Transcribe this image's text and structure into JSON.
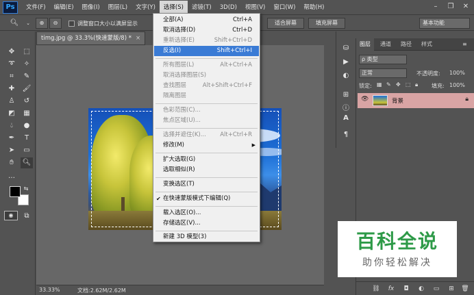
{
  "app": {
    "logo": "Ps"
  },
  "menubar": {
    "items": [
      "文件(F)",
      "编辑(E)",
      "图像(I)",
      "图层(L)",
      "文字(Y)",
      "选择(S)",
      "滤镜(T)",
      "3D(D)",
      "视图(V)",
      "窗口(W)",
      "帮助(H)"
    ],
    "active_index": 5
  },
  "options": {
    "resize_windows_label": "调整窗口大小以满屏显示",
    "fit_screen_label": "适合屏幕",
    "fill_screen_label": "填充屏幕",
    "workspace": "基本功能"
  },
  "document": {
    "tab_title": "timg.jpg @ 33.3%(快速蒙版/8) *",
    "close_glyph": "×",
    "zoom": "33.33%",
    "doc_size": "文档:2.62M/2.62M"
  },
  "select_menu": {
    "items": [
      {
        "label": "全部(A)",
        "shortcut": "Ctrl+A",
        "disabled": false
      },
      {
        "label": "取消选择(D)",
        "shortcut": "Ctrl+D",
        "disabled": false
      },
      {
        "label": "重新选择(E)",
        "shortcut": "Shift+Ctrl+D",
        "disabled": true
      },
      {
        "label": "反选(I)",
        "shortcut": "Shift+Ctrl+I",
        "disabled": false,
        "highlighted": true
      },
      {
        "label": "所有图层(L)",
        "shortcut": "Alt+Ctrl+A",
        "disabled": true
      },
      {
        "label": "取消选择图层(S)",
        "shortcut": "",
        "disabled": true
      },
      {
        "label": "查找图层",
        "shortcut": "Alt+Shift+Ctrl+F",
        "disabled": true
      },
      {
        "label": "隔离图层",
        "shortcut": "",
        "disabled": true
      },
      {
        "label": "色彩范围(C)...",
        "shortcut": "",
        "disabled": true
      },
      {
        "label": "焦点区域(U)...",
        "shortcut": "",
        "disabled": true
      },
      {
        "label": "选择并遮住(K)...",
        "shortcut": "Alt+Ctrl+R",
        "disabled": true
      },
      {
        "label": "修改(M)",
        "shortcut": "",
        "disabled": false,
        "submenu": true
      },
      {
        "label": "扩大选取(G)",
        "shortcut": "",
        "disabled": false
      },
      {
        "label": "选取相似(R)",
        "shortcut": "",
        "disabled": false
      },
      {
        "label": "变换选区(T)",
        "shortcut": "",
        "disabled": false
      },
      {
        "label": "在快速蒙版模式下编辑(Q)",
        "shortcut": "",
        "disabled": false,
        "checked": true
      },
      {
        "label": "载入选区(O)...",
        "shortcut": "",
        "disabled": false
      },
      {
        "label": "存储选区(V)...",
        "shortcut": "",
        "disabled": false
      },
      {
        "label": "新建 3D 模型(3)",
        "shortcut": "",
        "disabled": false
      }
    ]
  },
  "layers_panel": {
    "tabs": [
      "图层",
      "通道",
      "路径",
      "样式"
    ],
    "filter_kind": "ρ 类型",
    "blend_mode": "正常",
    "opacity_label": "不透明度:",
    "opacity_value": "100%",
    "lock_label": "锁定:",
    "fill_label": "填充:",
    "fill_value": "100%",
    "layer_name": "背景"
  },
  "watermark": {
    "title": "百科全说",
    "subtitle": "助你轻松解决"
  },
  "colors": {
    "highlight": "#3a7bd5",
    "layer_row": "#d9a4a4",
    "watermark_green": "#2e9a48"
  }
}
